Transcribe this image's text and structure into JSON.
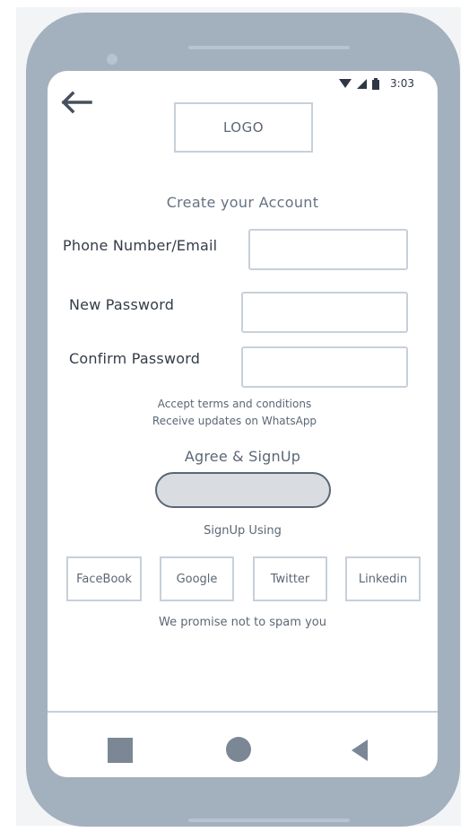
{
  "status_bar": {
    "time": "3:03"
  },
  "header": {
    "logo_text": "LOGO",
    "title": "Create your Account"
  },
  "form": {
    "phone_email_label": "Phone Number/Email",
    "phone_email_value": "",
    "new_password_label": "New Password",
    "new_password_value": "",
    "confirm_password_label": "Confirm Password",
    "confirm_password_value": ""
  },
  "terms": {
    "accept_terms": "Accept terms and conditions",
    "whatsapp_updates": "Receive updates on WhatsApp"
  },
  "signup": {
    "agree_label": "Agree & SignUp",
    "button_label": ""
  },
  "social": {
    "heading": "SignUp Using",
    "buttons": [
      "FaceBook",
      "Google",
      "Twitter",
      "Linkedin"
    ]
  },
  "footer": {
    "spam_note": "We promise not to spam you"
  },
  "icons": {
    "back": "arrow-left-icon",
    "wifi": "wifi-icon",
    "signal": "signal-icon",
    "battery": "battery-icon",
    "nav_recents": "square-icon",
    "nav_home": "circle-icon",
    "nav_back": "triangle-back-icon"
  },
  "colors": {
    "phone_body": "#a3b0be",
    "screen": "#ffffff",
    "border": "#c7d0da",
    "text_dark": "#333c47",
    "text_muted": "#5b6775",
    "button_fill": "#d9dde2",
    "nav_icon": "#7b8794"
  }
}
